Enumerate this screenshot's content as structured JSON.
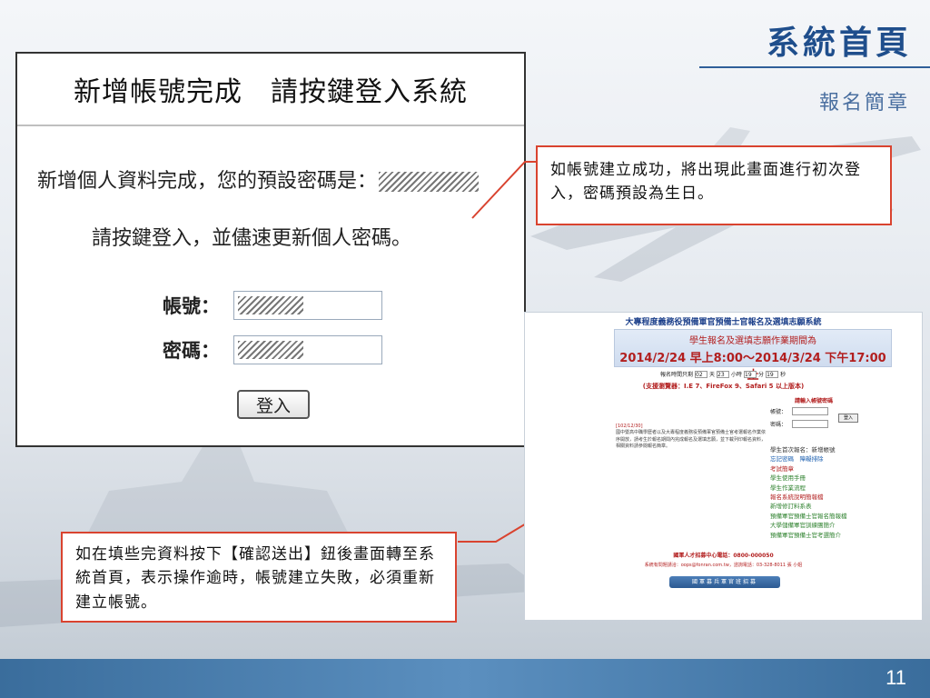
{
  "slide": {
    "title": "系統首頁",
    "subtitle": "報名簡章",
    "page_number": "11"
  },
  "panel": {
    "heading": "新增帳號完成　請按鍵登入系統",
    "message_1": "新增個人資料完成，您的預設密碼是：",
    "message_2": "請按鍵登入，並儘速更新個人密碼。",
    "account_label": "帳號：",
    "password_label": "密碼：",
    "login_button": "登入"
  },
  "callouts": {
    "top": "如帳號建立成功，將出現此畫面進行初次登入，密碼預設為生日。",
    "bottom": "如在填些完資料按下【確認送出】鈕後畫面轉至系統首頁，表示操作逾時，帳號建立失敗，必須重新建立帳號。"
  },
  "thumbnail": {
    "title": "大專程度義務役預備軍官預備士官報名及選填志願系統",
    "period_line": "學生報名及選填志願作業期間為",
    "period_dates": "2014/2/24 早上8:00～2014/3/24 下午17:00止",
    "time_remaining": {
      "prefix": "報名時間只剩",
      "days_value": "02",
      "days_label": "天",
      "hours_value": "23",
      "hours_label": "小時",
      "minutes_value": "19",
      "minutes_label": "分",
      "seconds_value": "19",
      "seconds_label": "秒"
    },
    "browser_note": "(支援瀏覽器：I.E 7、FireFox 9、Safari 5 以上版本)",
    "login_title": "請輸入帳號密碼",
    "account_label": "帳號：",
    "password_label": "密碼：",
    "login_button": "登入",
    "news_date": "[102/12/30]",
    "news_text": "國中暨高中職學歷者以及大專程度義務役預備軍官預備士官考選報名作業依序開放，請考生於報名期間內完成報名及選填志願，並下載列印報名資料，相關資料請參閱報名簡章。",
    "links": [
      "學生首次報名：新增帳號",
      "忘記密碼　障礙排除",
      "考試簡章",
      "學生使用手冊",
      "學生作業流程",
      "報名系統說明簡報檔",
      "新增修訂料系表",
      "預備軍官預備士官報名簡報檔",
      "大學儲備軍官訓練團簡介",
      "預備軍官預備士官考選簡介"
    ],
    "contact_phone": "國軍人才招募中心電話：0800-000050",
    "contact_email": "系統有問題請洽：oops@fonran.com.tw，諮詢電話：03-328-8011 張 小姐",
    "banner": "國軍募兵軍官班招募"
  },
  "colors": {
    "title": "#1f4e8c",
    "callout_border": "#d9432f",
    "bottom_bar": "#3a6d9c"
  }
}
